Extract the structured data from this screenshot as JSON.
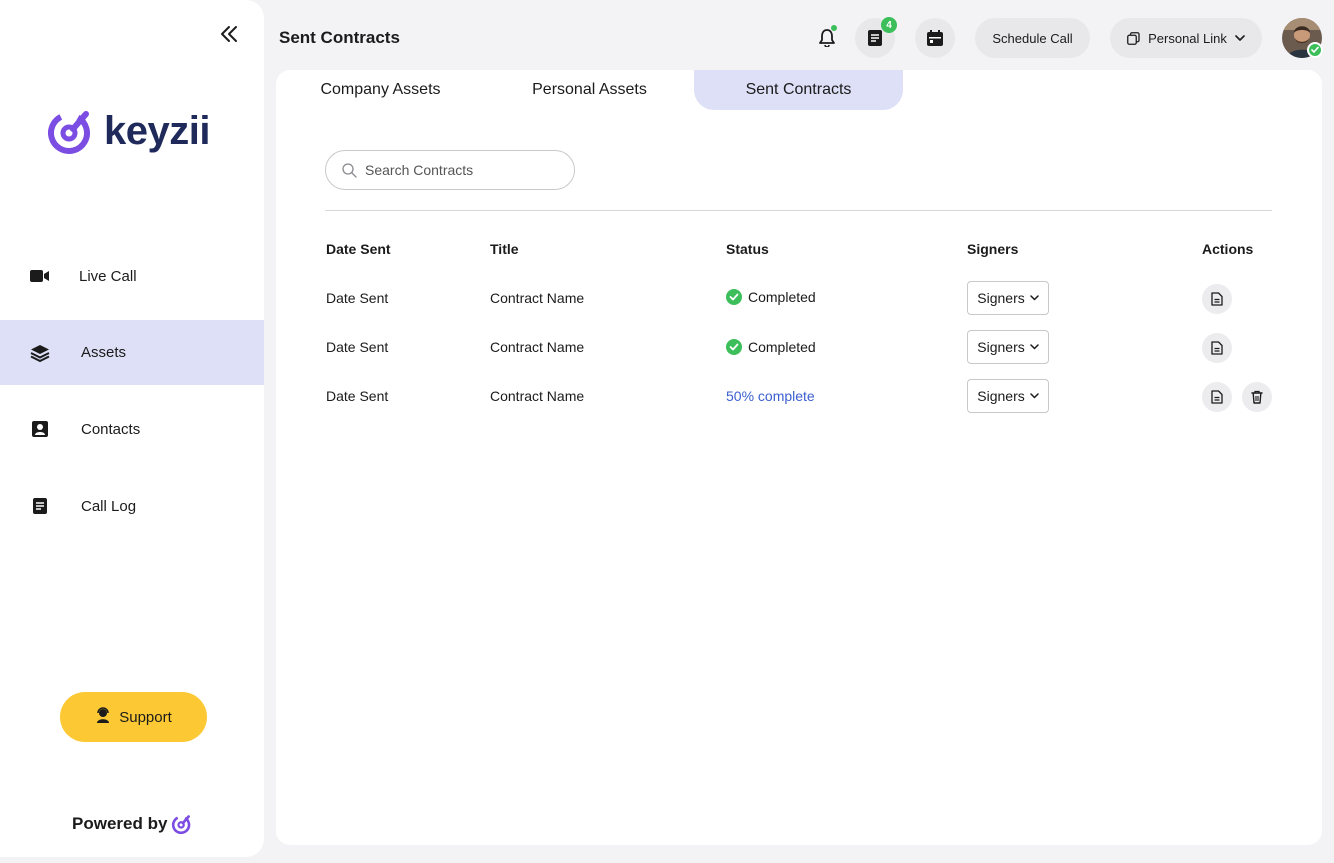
{
  "sidebar": {
    "brand": "keyzii",
    "items": [
      {
        "label": "Live Call",
        "icon": "video-icon"
      },
      {
        "label": "Assets",
        "icon": "layers-icon"
      },
      {
        "label": "Contacts",
        "icon": "contact-card-icon"
      },
      {
        "label": "Call Log",
        "icon": "document-icon"
      }
    ],
    "active_item": "Assets",
    "support_label": "Support",
    "powered_by": "Powered by"
  },
  "header": {
    "title": "Sent Contracts",
    "notes_badge": "4",
    "schedule_call_label": "Schedule Call",
    "personal_link_label": "Personal Link"
  },
  "tabs": [
    {
      "label": "Company Assets"
    },
    {
      "label": "Personal Assets"
    },
    {
      "label": "Sent Contracts"
    }
  ],
  "active_tab": "Sent Contracts",
  "search": {
    "placeholder": "Search Contracts",
    "value": ""
  },
  "table": {
    "columns": [
      "Date Sent",
      "Title",
      "Status",
      "Signers",
      "Actions"
    ],
    "rows": [
      {
        "date": "Date Sent",
        "title": "Contract Name",
        "status": "Completed",
        "status_type": "completed",
        "signers": "Signers",
        "actions": [
          "view"
        ]
      },
      {
        "date": "Date Sent",
        "title": "Contract Name",
        "status": "Completed",
        "status_type": "completed",
        "signers": "Signers",
        "actions": [
          "view"
        ]
      },
      {
        "date": "Date Sent",
        "title": "Contract Name",
        "status": "50% complete",
        "status_type": "progress",
        "signers": "Signers",
        "actions": [
          "view",
          "delete"
        ]
      }
    ]
  },
  "colors": {
    "accent_purple": "#7b4de3",
    "brand_navy": "#1f2a5a",
    "active_bg": "#dde0f6",
    "support_yellow": "#fcc934",
    "success_green": "#3cbf5b",
    "link_blue": "#3b5fcf"
  }
}
